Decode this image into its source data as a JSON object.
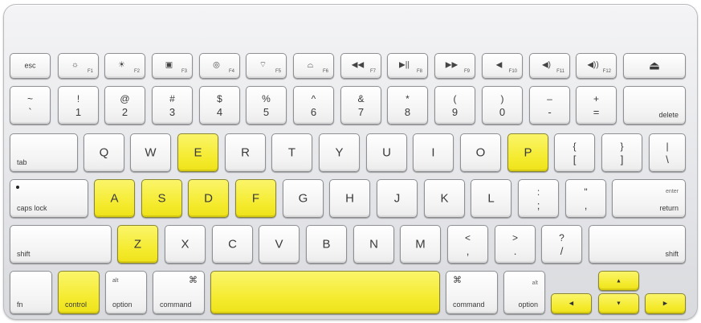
{
  "highlight_color": "#f4ea2a",
  "highlighted_keys": [
    "E",
    "P",
    "A",
    "S",
    "D",
    "F",
    "Z",
    "control",
    "space",
    "up",
    "left",
    "down",
    "right"
  ],
  "fn_row": [
    {
      "name": "esc",
      "label": "esc",
      "num": ""
    },
    {
      "name": "f1",
      "icon": "☼",
      "num": "F1"
    },
    {
      "name": "f2",
      "icon": "☀",
      "num": "F2"
    },
    {
      "name": "f3",
      "icon": "▣",
      "num": "F3"
    },
    {
      "name": "f4",
      "icon": "◎",
      "num": "F4"
    },
    {
      "name": "f5",
      "icon": "⌔",
      "num": "F5"
    },
    {
      "name": "f6",
      "icon": "⌓",
      "num": "F6"
    },
    {
      "name": "f7",
      "icon": "◀◀",
      "num": "F7"
    },
    {
      "name": "f8",
      "icon": "▶||",
      "num": "F8"
    },
    {
      "name": "f9",
      "icon": "▶▶",
      "num": "F9"
    },
    {
      "name": "f10",
      "icon": "◀",
      "num": "F10"
    },
    {
      "name": "f11",
      "icon": "◀)",
      "num": "F11"
    },
    {
      "name": "f12",
      "icon": "◀))",
      "num": "F12"
    },
    {
      "name": "eject",
      "icon": "⏏",
      "num": ""
    }
  ],
  "number_row": [
    {
      "top": "~",
      "bot": "`"
    },
    {
      "top": "!",
      "bot": "1"
    },
    {
      "top": "@",
      "bot": "2"
    },
    {
      "top": "#",
      "bot": "3"
    },
    {
      "top": "$",
      "bot": "4"
    },
    {
      "top": "%",
      "bot": "5"
    },
    {
      "top": "^",
      "bot": "6"
    },
    {
      "top": "&",
      "bot": "7"
    },
    {
      "top": "*",
      "bot": "8"
    },
    {
      "top": "(",
      "bot": "9"
    },
    {
      "top": ")",
      "bot": "0"
    },
    {
      "top": "–",
      "bot": "-"
    },
    {
      "top": "+",
      "bot": "="
    }
  ],
  "delete_label": "delete",
  "tab_label": "tab",
  "qwerty_row": [
    "Q",
    "W",
    "E",
    "R",
    "T",
    "Y",
    "U",
    "I",
    "O",
    "P"
  ],
  "bracket_keys": [
    {
      "top": "{",
      "bot": "["
    },
    {
      "top": "}",
      "bot": "]"
    },
    {
      "top": "|",
      "bot": "\\"
    }
  ],
  "capslock_label": "caps lock",
  "home_row": [
    "A",
    "S",
    "D",
    "F",
    "G",
    "H",
    "J",
    "K",
    "L"
  ],
  "home_punct": [
    {
      "top": ":",
      "bot": ";"
    },
    {
      "top": "\"",
      "bot": ","
    }
  ],
  "enter_label": "enter",
  "return_label": "return",
  "shift_label": "shift",
  "bottom_letters": [
    "Z",
    "X",
    "C",
    "V",
    "B",
    "N",
    "M"
  ],
  "bottom_punct": [
    {
      "top": "<",
      "bot": ","
    },
    {
      "top": ">",
      "bot": "."
    },
    {
      "top": "?",
      "bot": "/"
    }
  ],
  "fn_label": "fn",
  "control_label": "control",
  "alt_label": "alt",
  "option_label": "option",
  "command_symbol": "⌘",
  "command_label": "command",
  "arrows": {
    "up": "▲",
    "left": "◀",
    "down": "▼",
    "right": "▶"
  }
}
